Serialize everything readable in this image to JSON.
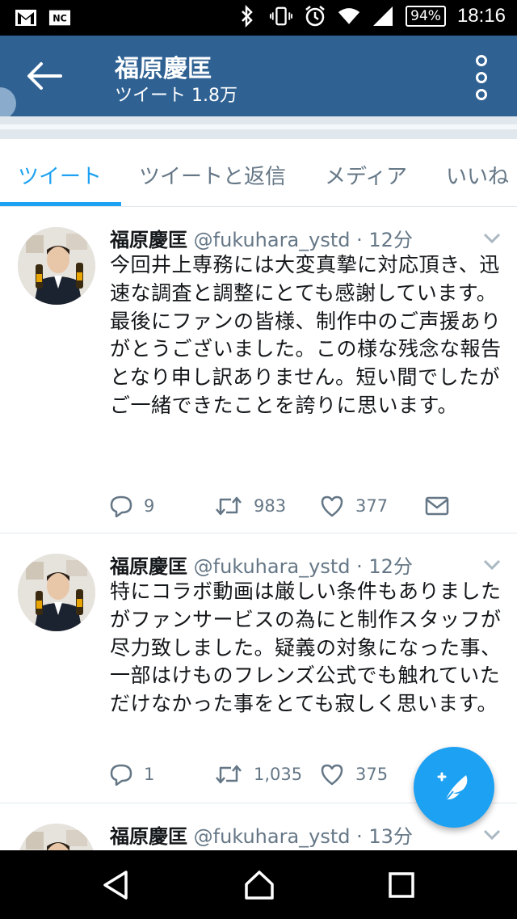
{
  "status_bar": {
    "battery": "94%",
    "time": "18:16",
    "icons": [
      "gmail-icon",
      "nhk-icon",
      "bluetooth-icon",
      "vibrate-icon",
      "alarm-icon",
      "wifi-icon",
      "signal-icon"
    ]
  },
  "app_bar": {
    "title": "福原慶匡",
    "subtitle": "ツイート 1.8万"
  },
  "tabs": [
    {
      "label": "ツイート",
      "active": true
    },
    {
      "label": "ツイートと返信",
      "active": false
    },
    {
      "label": "メディア",
      "active": false
    },
    {
      "label": "いいね",
      "active": false
    }
  ],
  "tweets": [
    {
      "name": "福原慶匡",
      "meta": "@fukuhara_ystd · 12分",
      "text": "今回井上専務には大変真摯に対応頂き、迅速な調査と調整にとても感謝しています。\n最後にファンの皆様、制作中のご声援ありがとうございました。この様な残念な報告となり申し訳ありません。短い間でしたがご一緒できたことを誇りに思います。",
      "replies": "9",
      "retweets": "983",
      "likes": "377"
    },
    {
      "name": "福原慶匡",
      "meta": "@fukuhara_ystd · 12分",
      "text": "特にコラボ動画は厳しい条件もありましたがファンサービスの為にと制作スタッフが尽力致しました。疑義の対象になった事、一部はけものフレンズ公式でも触れていただけなかった事をとても寂しく思います。",
      "replies": "1",
      "retweets": "1,035",
      "likes": "375"
    },
    {
      "name": "福原慶匡",
      "meta": "@fukuhara_ystd · 13分"
    }
  ],
  "colors": {
    "app_bar": "#2f6193",
    "accent": "#1da1f2",
    "secondary_text": "#657786"
  }
}
